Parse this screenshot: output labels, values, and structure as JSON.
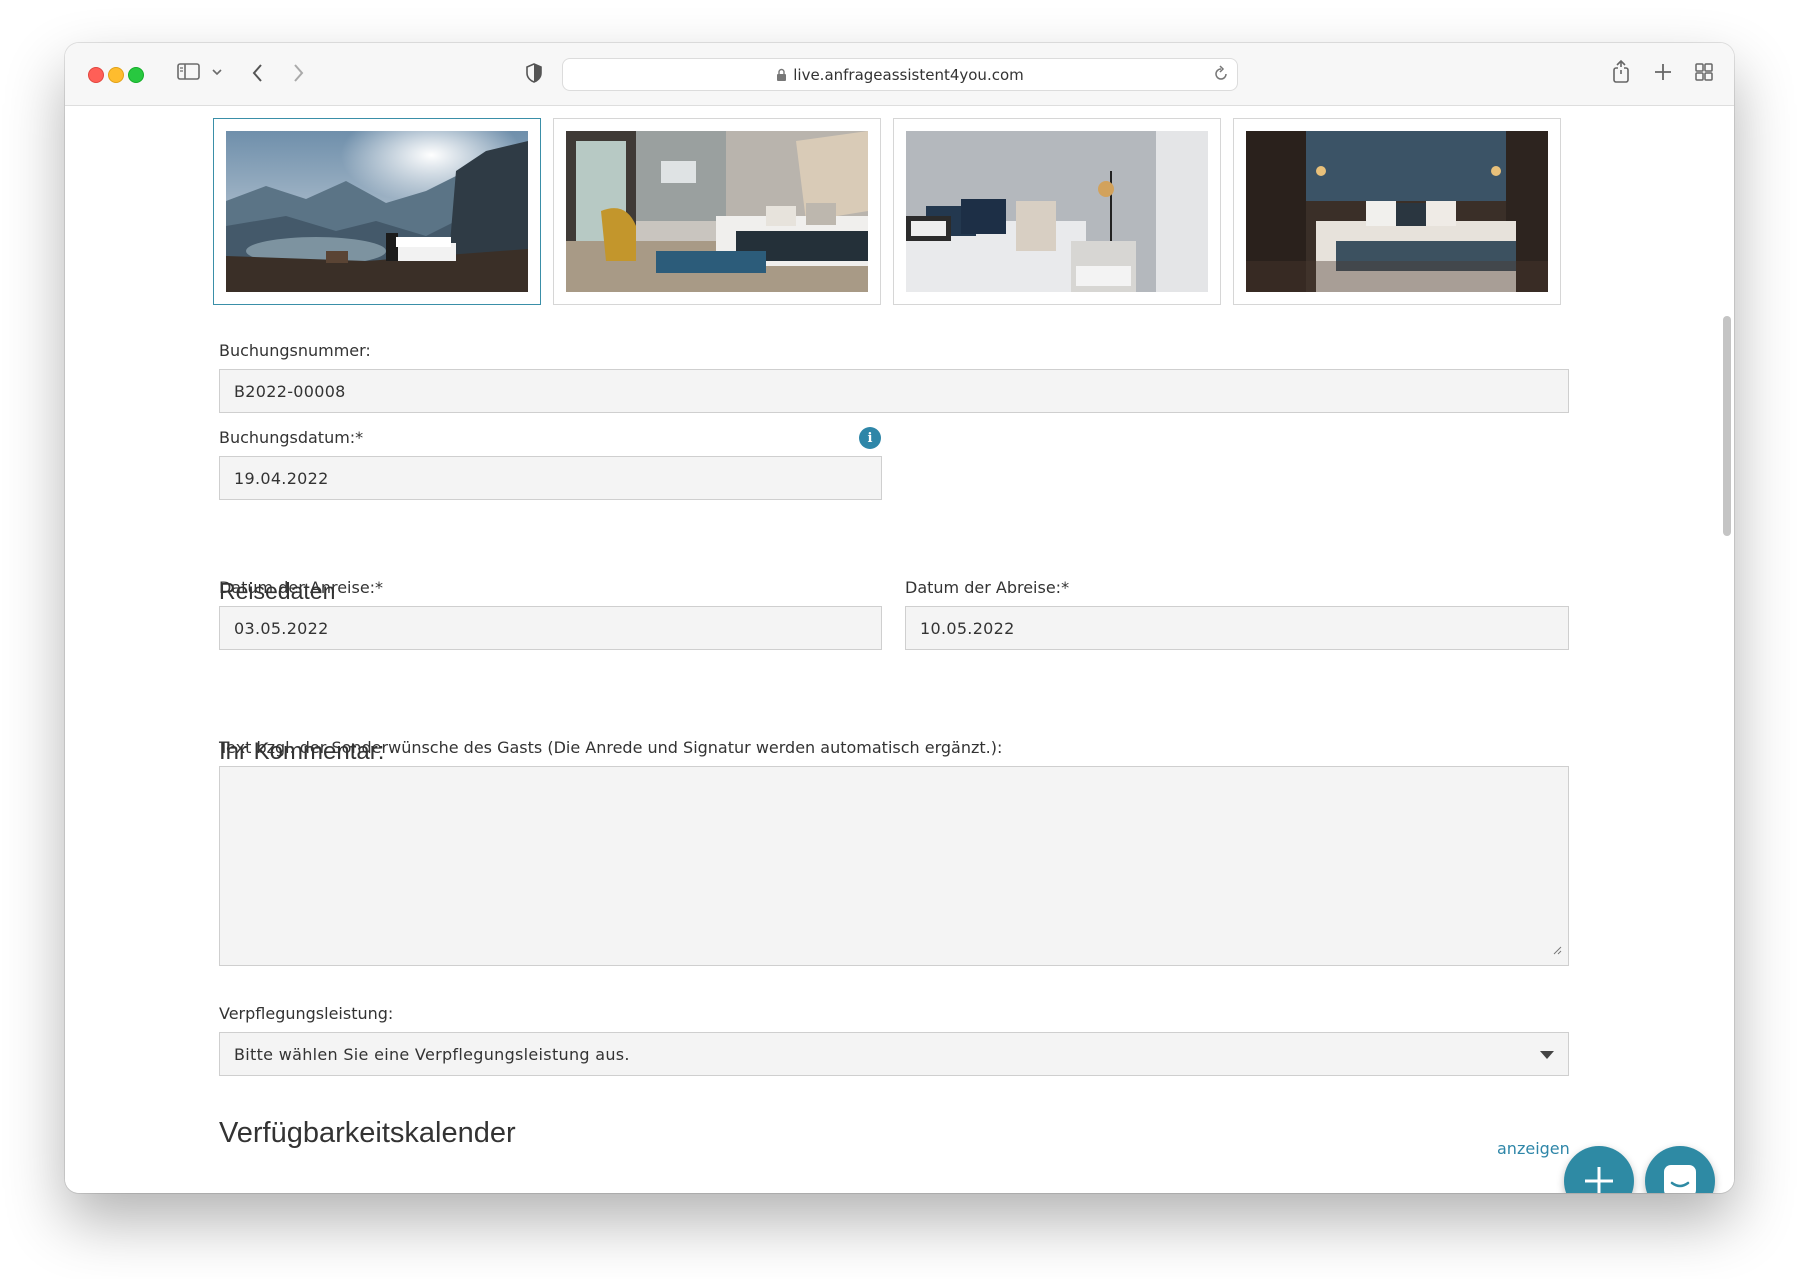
{
  "browser": {
    "url": "live.anfrageassistent4you.com"
  },
  "gallery": {
    "images": [
      {
        "name": "mountain-view-bed-photo",
        "selected": true
      },
      {
        "name": "hotel-room-armchair-photo",
        "selected": false
      },
      {
        "name": "bedside-lamp-photo",
        "selected": false
      },
      {
        "name": "dark-hotel-room-photo",
        "selected": false
      }
    ]
  },
  "form": {
    "booking_number_label": "Buchungsnummer:",
    "booking_number_value": "B2022-00008",
    "booking_date_label": "Buchungsdatum:*",
    "booking_date_value": "19.04.2022",
    "info_badge": "i",
    "travel_section_title": "Reisedaten",
    "arrival_label": "Datum der Anreise:*",
    "arrival_value": "03.05.2022",
    "departure_label": "Datum der Abreise:*",
    "departure_value": "10.05.2022",
    "comment_title": "Ihr Kommentar:",
    "comment_hint": "Text bzgl. der Sonderwünsche des Gasts (Die Anrede und Signatur werden automatisch ergänzt.):",
    "comment_value": "",
    "board_label": "Verpflegungsleistung:",
    "board_selected": "Bitte wählen Sie eine Verpflegungsleistung aus.",
    "calendar_title": "Verfügbarkeitskalender",
    "calendar_toggle": "anzeigen"
  },
  "colors": {
    "accent": "#2e86a8",
    "field_bg": "#f4f4f4",
    "field_border": "#cfcfcf"
  }
}
